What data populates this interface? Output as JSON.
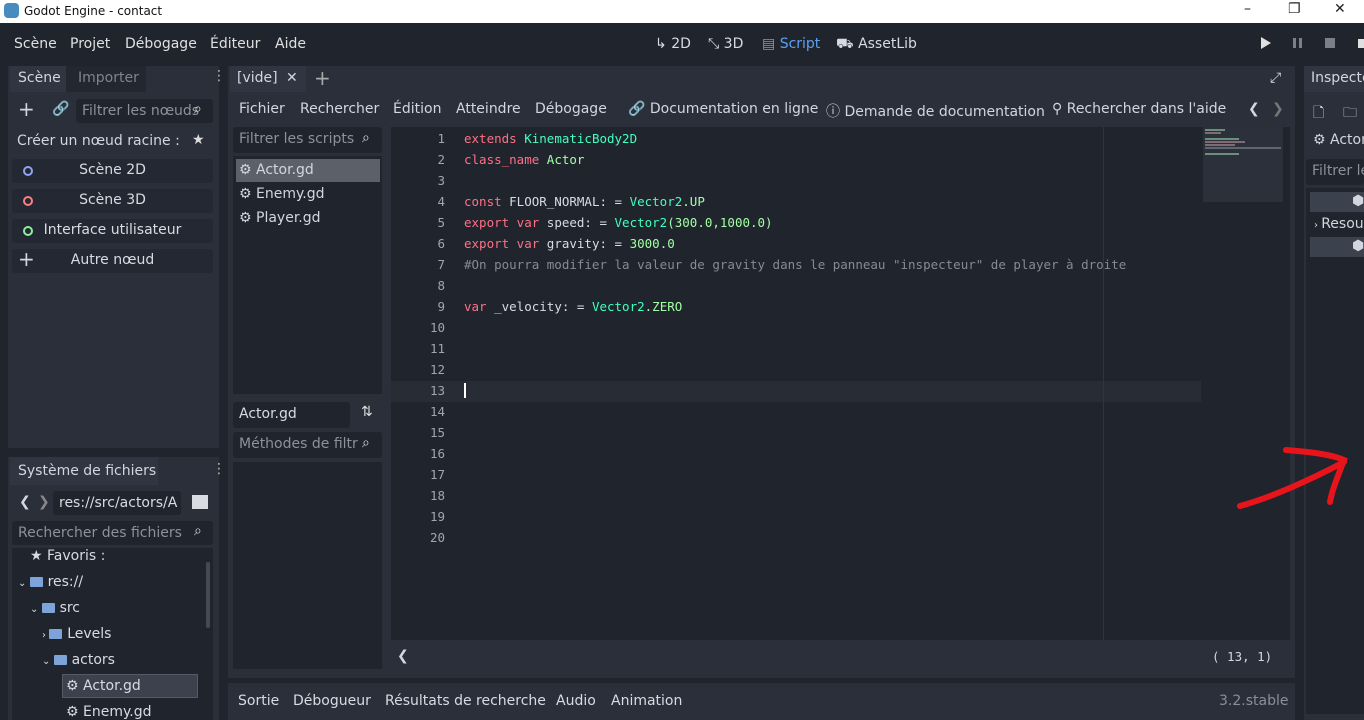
{
  "window": {
    "title": "Godot Engine - contact",
    "controls": [
      "–",
      "❐",
      "✕"
    ]
  },
  "menu": [
    "Scène",
    "Projet",
    "Débogage",
    "Éditeur",
    "Aide"
  ],
  "workspaces": [
    "2D",
    "3D",
    "Script",
    "AssetLib"
  ],
  "scene_dock": {
    "tabs": [
      "Scène",
      "Importer"
    ],
    "filter_placeholder": "Filtrer les nœuds",
    "create_root_label": "Créer un nœud racine :",
    "root_options": [
      "Scène 2D",
      "Scène 3D",
      "Interface utilisateur",
      "Autre nœud"
    ]
  },
  "filesystem": {
    "title": "Système de fichiers",
    "path": "res://src/actors/A",
    "search_placeholder": "Rechercher des fichiers",
    "tree": [
      "Favoris :",
      "res://",
      "src",
      "Levels",
      "actors",
      "Actor.gd",
      "Enemy.gd"
    ]
  },
  "editor_tabs": [
    "[vide]"
  ],
  "script_menu": [
    "Fichier",
    "Rechercher",
    "Édition",
    "Atteindre",
    "Débogage"
  ],
  "help_links": [
    "Documentation en ligne",
    "Demande de documentation",
    "Rechercher dans l'aide"
  ],
  "scripts": {
    "filter_placeholder": "Filtrer les scripts",
    "items": [
      "Actor.gd",
      "Enemy.gd",
      "Player.gd"
    ]
  },
  "methods": {
    "current": "Actor.gd",
    "filter_placeholder": "Méthodes de filtr"
  },
  "code_lines": [
    [
      {
        "t": "extends ",
        "c": "kw"
      },
      {
        "t": "KinematicBody2D",
        "c": "ty"
      }
    ],
    [
      {
        "t": "class_name ",
        "c": "kw"
      },
      {
        "t": "Actor",
        "c": "nm"
      }
    ],
    [],
    [
      {
        "t": "const ",
        "c": "kw"
      },
      {
        "t": "FLOOR_NORMAL: = ",
        "c": "tx"
      },
      {
        "t": "Vector2",
        "c": "ty"
      },
      {
        "t": ".UP",
        "c": "nm"
      }
    ],
    [
      {
        "t": "export var ",
        "c": "kw"
      },
      {
        "t": "speed: = ",
        "c": "tx"
      },
      {
        "t": "Vector2",
        "c": "ty"
      },
      {
        "t": "(300.0,1000.0)",
        "c": "nm"
      }
    ],
    [
      {
        "t": "export var ",
        "c": "kw"
      },
      {
        "t": "gravity: = ",
        "c": "tx"
      },
      {
        "t": "3000.0",
        "c": "nm"
      }
    ],
    [
      {
        "t": "#On pourra modifier la valeur de gravity dans le panneau \"inspecteur\" de player à droite",
        "c": "cm"
      }
    ],
    [],
    [
      {
        "t": "var ",
        "c": "kw"
      },
      {
        "t": "_velocity: = ",
        "c": "tx"
      },
      {
        "t": "Vector2",
        "c": "ty"
      },
      {
        "t": ".ZERO",
        "c": "nm"
      }
    ],
    [],
    [],
    [],
    [],
    [],
    [],
    [],
    [],
    [],
    [],
    []
  ],
  "cursor_position": "( 13,  1)",
  "bottom_tabs": [
    "Sortie",
    "Débogueur",
    "Résultats de recherche",
    "Audio",
    "Animation"
  ],
  "version": "3.2.stable",
  "inspector": {
    "title": "Inspecte",
    "node": "Actor",
    "filter_placeholder": "Filtrer le",
    "section": "Resou"
  },
  "colors": {
    "accent": "#5fa0f0",
    "annotation": "#e8141c"
  }
}
